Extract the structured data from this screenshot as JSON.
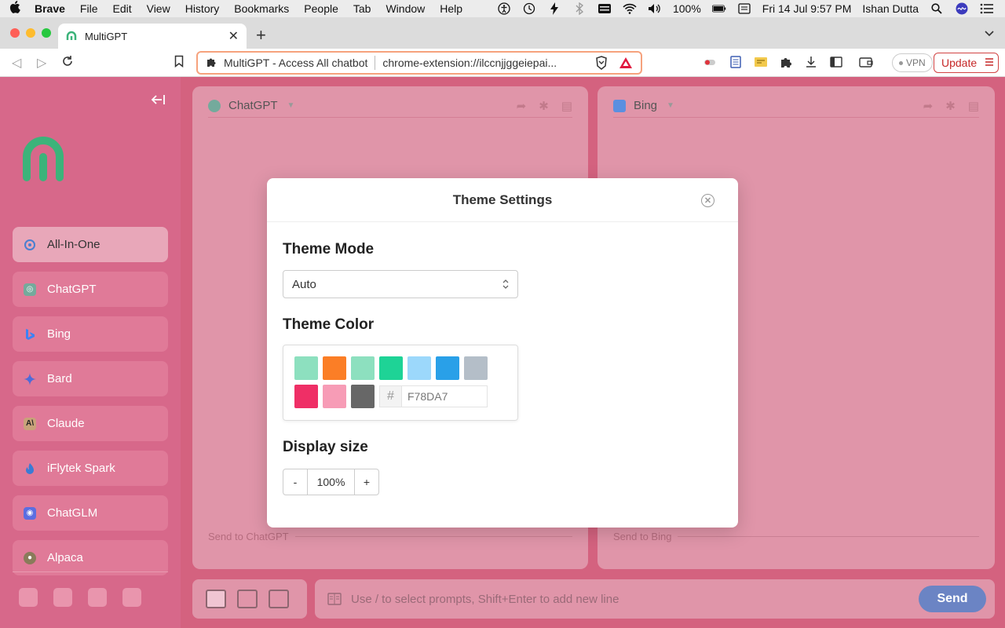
{
  "menubar": {
    "items": [
      "Brave",
      "File",
      "Edit",
      "View",
      "History",
      "Bookmarks",
      "People",
      "Tab",
      "Window",
      "Help"
    ],
    "battery": "100%",
    "clock": "Fri 14 Jul  9:57 PM",
    "user": "Ishan Dutta"
  },
  "browser": {
    "tab_title": "MultiGPT",
    "page_title": "MultiGPT - Access All chatbot",
    "url": "chrome-extension://ilccnjjggeiepai...",
    "vpn_label": "VPN",
    "update_label": "Update"
  },
  "sidebar": {
    "items": [
      {
        "label": "All-In-One",
        "icon": "openai-icon",
        "color": "#4a7fd0"
      },
      {
        "label": "ChatGPT",
        "icon": "chatgpt-icon",
        "color": "#74aa9c"
      },
      {
        "label": "Bing",
        "icon": "bing-icon",
        "color": "#3b82f6"
      },
      {
        "label": "Bard",
        "icon": "bard-icon",
        "color": "#4f6bd8"
      },
      {
        "label": "Claude",
        "icon": "claude-icon",
        "color": "#c9a27a"
      },
      {
        "label": "iFlytek Spark",
        "icon": "spark-icon",
        "color": "#3a7bd5"
      },
      {
        "label": "ChatGLM",
        "icon": "chatglm-icon",
        "color": "#5b6ee1"
      },
      {
        "label": "Alpaca",
        "icon": "alpaca-icon",
        "color": "#8a7b5a"
      }
    ]
  },
  "panels": {
    "chatgpt": {
      "name": "ChatGPT",
      "send_to": "Send to ChatGPT"
    },
    "bing": {
      "name": "Bing",
      "send_to": "Send to Bing"
    }
  },
  "prompt": {
    "placeholder": "Use / to select prompts, Shift+Enter to add new line",
    "send_label": "Send"
  },
  "modal": {
    "title": "Theme Settings",
    "theme_mode_label": "Theme Mode",
    "theme_mode_value": "Auto",
    "theme_color_label": "Theme Color",
    "swatches": [
      "#8de0bf",
      "#fb7e26",
      "#8de0bf",
      "#1ed396",
      "#9cd8fb",
      "#29a0e8",
      "#b4bec8",
      "#ef2f66",
      "#f79cb6",
      "#676767"
    ],
    "selected_swatch": "#f79cb6",
    "hex_value": "F78DA7",
    "display_size_label": "Display size",
    "display_size_value": "100%",
    "decrement_label": "-",
    "increment_label": "+"
  },
  "colors": {
    "accent": "#f78da7",
    "sidebar_bg": "#d7688a",
    "send_button": "#6b84c4"
  }
}
